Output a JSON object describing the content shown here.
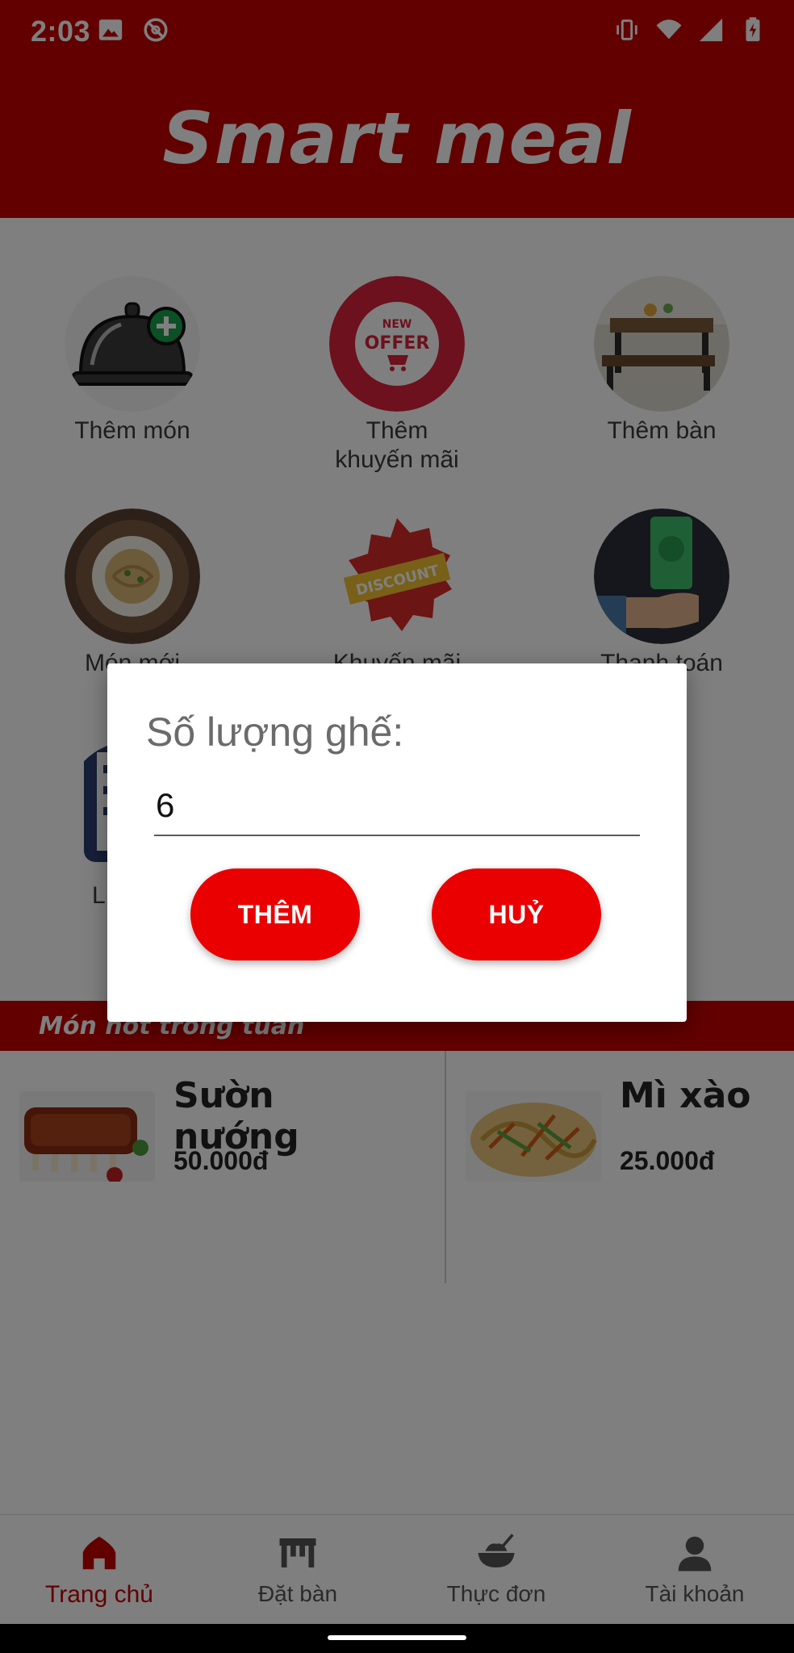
{
  "status_bar": {
    "time": "2:03",
    "icons_left": [
      "image-icon",
      "no-sync-icon"
    ],
    "icons_right": [
      "vibrate-icon",
      "wifi-icon",
      "signal-icon",
      "battery-charging-icon"
    ]
  },
  "header": {
    "title": "Smart meal"
  },
  "grid": [
    {
      "label": "Thêm món",
      "icon": "cloche-add-icon"
    },
    {
      "label": "Thêm\nkhuyến mãi",
      "icon": "new-offer-icon"
    },
    {
      "label": "Thêm bàn",
      "icon": "table-icon"
    },
    {
      "label": "Món mới",
      "icon": "noodle-plate-icon"
    },
    {
      "label": "Khuyến mãi",
      "icon": "discount-badge-icon"
    },
    {
      "label": "Thanh toán",
      "icon": "payment-hand-icon"
    },
    {
      "label": "L",
      "icon": "list-icon"
    }
  ],
  "hot_section": {
    "title": "Món hot trong tuần",
    "items": [
      {
        "name": "Sườn nướng",
        "price": "50.000đ",
        "image": "grilled-ribs"
      },
      {
        "name": "Mì xào",
        "price": "25.000đ",
        "image": "stir-fried-noodles"
      }
    ]
  },
  "bottom_nav": [
    {
      "label": "Trang chủ",
      "icon": "home-icon",
      "active": true
    },
    {
      "label": "Đặt bàn",
      "icon": "table-icon",
      "active": false
    },
    {
      "label": "Thực đơn",
      "icon": "food-bowl-icon",
      "active": false
    },
    {
      "label": "Tài khoản",
      "icon": "person-icon",
      "active": false
    }
  ],
  "dialog": {
    "title": "Số lượng ghế:",
    "input_value": "6",
    "add_label": "THÊM",
    "cancel_label": "HUỶ"
  },
  "colors": {
    "primary": "#c40000",
    "button": "#ea0000",
    "scrim": "rgba(0,0,0,0.5)"
  }
}
